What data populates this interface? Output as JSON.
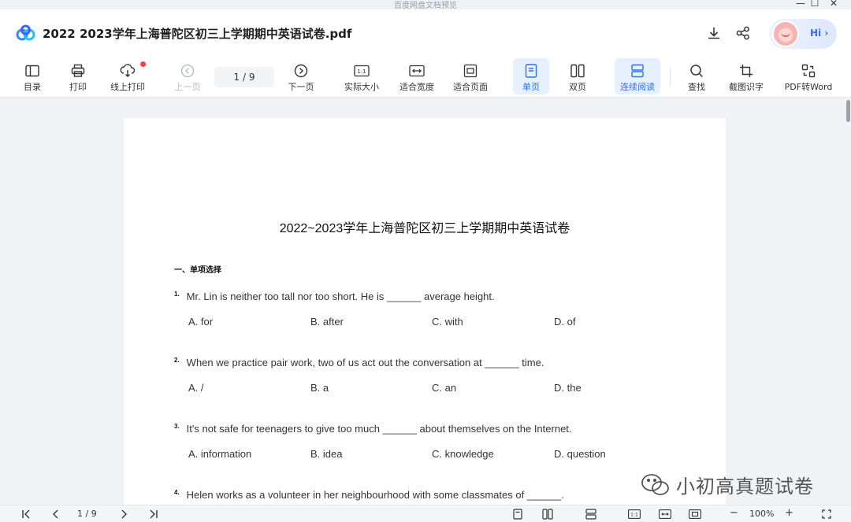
{
  "window": {
    "app_title": "百度网盘文档预览",
    "minimize": "—",
    "maximize": "☐",
    "close": "✕"
  },
  "header": {
    "doc_title": "2022 2023学年上海普陀区初三上学期期中英语试卷.pdf",
    "hi_label": "Hi ›"
  },
  "toolbar": {
    "toc": "目录",
    "print": "打印",
    "online_print": "线上打印",
    "prev": "上一页",
    "page_indicator": "1  /  9",
    "next": "下一页",
    "actual_size": "实际大小",
    "fit_width": "适合宽度",
    "fit_page": "适合页面",
    "single_page": "单页",
    "double_page": "双页",
    "continuous": "连续阅读",
    "find": "查找",
    "screenshot_ocr": "截图识字",
    "pdf_to_word": "PDF转Word"
  },
  "document": {
    "title": "2022~2023学年上海普陀区初三上学期期中英语试卷",
    "section": "一、单项选择",
    "questions": [
      {
        "num": "1.",
        "text": "Mr. Lin is neither too tall nor too short. He is ______ average height.",
        "options": [
          "A. for",
          "B. after",
          "C. with",
          "D. of"
        ]
      },
      {
        "num": "2.",
        "text": "When we practice pair work, two of us act out the conversation at ______ time.",
        "options": [
          "A. /",
          "B. a",
          "C. an",
          "D. the"
        ]
      },
      {
        "num": "3.",
        "text": "It's not safe for teenagers to give too much ______ about themselves on the Internet.",
        "options": [
          "A. information",
          "B. idea",
          "C. knowledge",
          "D. question"
        ]
      },
      {
        "num": "4.",
        "text": "Helen works as a volunteer in her neighbourhood with some classmates of ______.",
        "options": []
      }
    ]
  },
  "watermark": {
    "text": "小初高真题试卷"
  },
  "statusbar": {
    "page_indicator": "1 / 9",
    "zoom": "100%",
    "zoom_out": "−",
    "zoom_in": "+"
  },
  "colors": {
    "accent": "#2f6ff0",
    "active_bg": "#e6f0ff",
    "notify_dot": "#ff3b4d"
  }
}
